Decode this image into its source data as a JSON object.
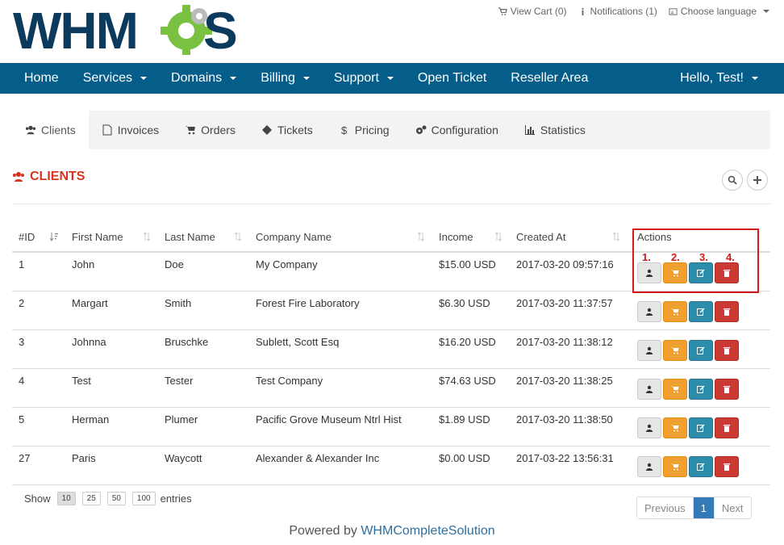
{
  "brand": {
    "logo_text": "WHMCS",
    "primary": "#055d8a",
    "accent": "#7ac142"
  },
  "toplinks": {
    "cart": "View Cart (0)",
    "notifications": "Notifications (1)",
    "language": "Choose language"
  },
  "nav": {
    "items": [
      {
        "label": "Home"
      },
      {
        "label": "Services"
      },
      {
        "label": "Domains"
      },
      {
        "label": "Billing"
      },
      {
        "label": "Support"
      },
      {
        "label": "Open Ticket"
      },
      {
        "label": "Reseller Area"
      }
    ],
    "user": "Hello, Test!"
  },
  "tabs": [
    {
      "label": "Clients",
      "icon": "users-icon"
    },
    {
      "label": "Invoices",
      "icon": "file-icon"
    },
    {
      "label": "Orders",
      "icon": "cart-icon"
    },
    {
      "label": "Tickets",
      "icon": "ticket-icon"
    },
    {
      "label": "Pricing",
      "icon": "dollar-icon"
    },
    {
      "label": "Configuration",
      "icon": "cogs-icon"
    },
    {
      "label": "Statistics",
      "icon": "chart-icon"
    }
  ],
  "section_title": "CLIENTS",
  "table": {
    "headers": [
      "#ID",
      "First Name",
      "Last Name",
      "Company Name",
      "Income",
      "Created At",
      "Actions"
    ],
    "rows": [
      [
        "1",
        "John",
        "Doe",
        "My Company",
        "$15.00 USD",
        "2017-03-20 09:57:16"
      ],
      [
        "2",
        "Margart",
        "Smith",
        "Forest Fire Laboratory",
        "$6.30 USD",
        "2017-03-20 11:37:57"
      ],
      [
        "3",
        "Johnna",
        "Bruschke",
        "Sublett, Scott Esq",
        "$16.20 USD",
        "2017-03-20 11:38:12"
      ],
      [
        "4",
        "Test",
        "Tester",
        "Test Company",
        "$74.63 USD",
        "2017-03-20 11:38:25"
      ],
      [
        "5",
        "Herman",
        "Plumer",
        "Pacific Grove Museum Ntrl Hist",
        "$1.89 USD",
        "2017-03-20 11:38:50"
      ],
      [
        "27",
        "Paris",
        "Waycott",
        "Alexander & Alexander Inc",
        "$0.00 USD",
        "2017-03-22 13:56:31"
      ]
    ]
  },
  "annotations": [
    "1.",
    "2.",
    "3.",
    "4."
  ],
  "length_menu": {
    "prefix": "Show",
    "options": [
      "10",
      "25",
      "50",
      "100"
    ],
    "selected": "10",
    "suffix": "entries"
  },
  "pager": {
    "previous": "Previous",
    "current": "1",
    "next": "Next"
  },
  "footer": {
    "prefix": "Powered by",
    "link": "WHMCompleteSolution"
  }
}
